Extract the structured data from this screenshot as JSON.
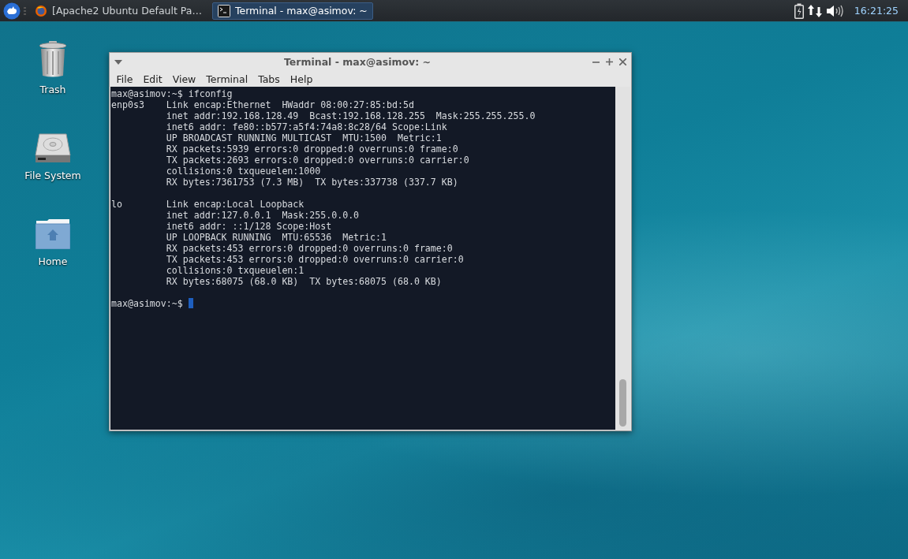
{
  "taskbar": {
    "tasks": [
      {
        "kind": "browser",
        "label": "[Apache2 Ubuntu Default Pa…",
        "selected": false
      },
      {
        "kind": "terminal",
        "label": "Terminal - max@asimov: ~",
        "selected": true
      }
    ],
    "clock": "16:21:25"
  },
  "desktop_icons": [
    {
      "kind": "trash",
      "label": "Trash"
    },
    {
      "kind": "drive",
      "label": "File System"
    },
    {
      "kind": "home",
      "label": "Home"
    }
  ],
  "window": {
    "title": "Terminal - max@asimov: ~",
    "menu": [
      "File",
      "Edit",
      "View",
      "Terminal",
      "Tabs",
      "Help"
    ],
    "blocks": [
      [
        "max@asimov:~$ ifconfig",
        "enp0s3    Link encap:Ethernet  HWaddr 08:00:27:85:bd:5d",
        "          inet addr:192.168.128.49  Bcast:192.168.128.255  Mask:255.255.255.0",
        "          inet6 addr: fe80::b577:a5f4:74a8:8c28/64 Scope:Link",
        "          UP BROADCAST RUNNING MULTICAST  MTU:1500  Metric:1",
        "          RX packets:5939 errors:0 dropped:0 overruns:0 frame:0",
        "          TX packets:2693 errors:0 dropped:0 overruns:0 carrier:0",
        "          collisions:0 txqueuelen:1000",
        "          RX bytes:7361753 (7.3 MB)  TX bytes:337738 (337.7 KB)"
      ],
      [
        "lo        Link encap:Local Loopback",
        "          inet addr:127.0.0.1  Mask:255.0.0.0",
        "          inet6 addr: ::1/128 Scope:Host",
        "          UP LOOPBACK RUNNING  MTU:65536  Metric:1",
        "          RX packets:453 errors:0 dropped:0 overruns:0 frame:0",
        "          TX packets:453 errors:0 dropped:0 overruns:0 carrier:0",
        "          collisions:0 txqueuelen:1",
        "          RX bytes:68075 (68.0 KB)  TX bytes:68075 (68.0 KB)"
      ],
      [
        "max@asimov:~$"
      ]
    ],
    "cursor": true
  }
}
